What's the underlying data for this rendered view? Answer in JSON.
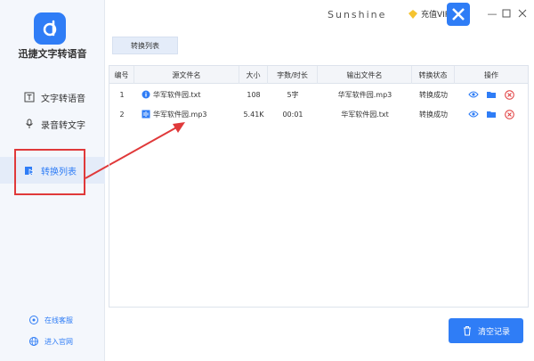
{
  "app": {
    "title": "迅捷文字转语音"
  },
  "sidebar": {
    "items": [
      {
        "label": "文字转语音",
        "icon": "text-to-speech-icon"
      },
      {
        "label": "录音转文字",
        "icon": "mic-icon"
      },
      {
        "label": "转换列表",
        "icon": "convert-list-icon",
        "active": true
      }
    ],
    "footer": [
      {
        "label": "在线客服",
        "icon": "support-icon"
      },
      {
        "label": "进入官网",
        "icon": "globe-icon"
      }
    ]
  },
  "header": {
    "username": "Sunshine",
    "vip_label": "充值VIP",
    "window_controls": [
      "minimize",
      "maximize",
      "close"
    ]
  },
  "tabs": [
    {
      "label": "转换列表"
    }
  ],
  "table": {
    "columns": [
      "编号",
      "源文件名",
      "大小",
      "字数/时长",
      "输出文件名",
      "转换状态",
      "操作"
    ],
    "rows": [
      {
        "id": "1",
        "source": "华军软件园.txt",
        "source_type": "text",
        "size": "108",
        "length": "5字",
        "output": "华军软件园.mp3",
        "status": "转换成功"
      },
      {
        "id": "2",
        "source": "华军软件园.mp3",
        "source_type": "audio",
        "size": "5.41K",
        "length": "00:01",
        "output": "华军软件园.txt",
        "status": "转换成功"
      }
    ]
  },
  "actions": {
    "clear_label": "清空记录"
  },
  "colors": {
    "accent": "#2f7df6",
    "danger": "#e0393a",
    "sidebar_bg": "#f4f7fc"
  }
}
